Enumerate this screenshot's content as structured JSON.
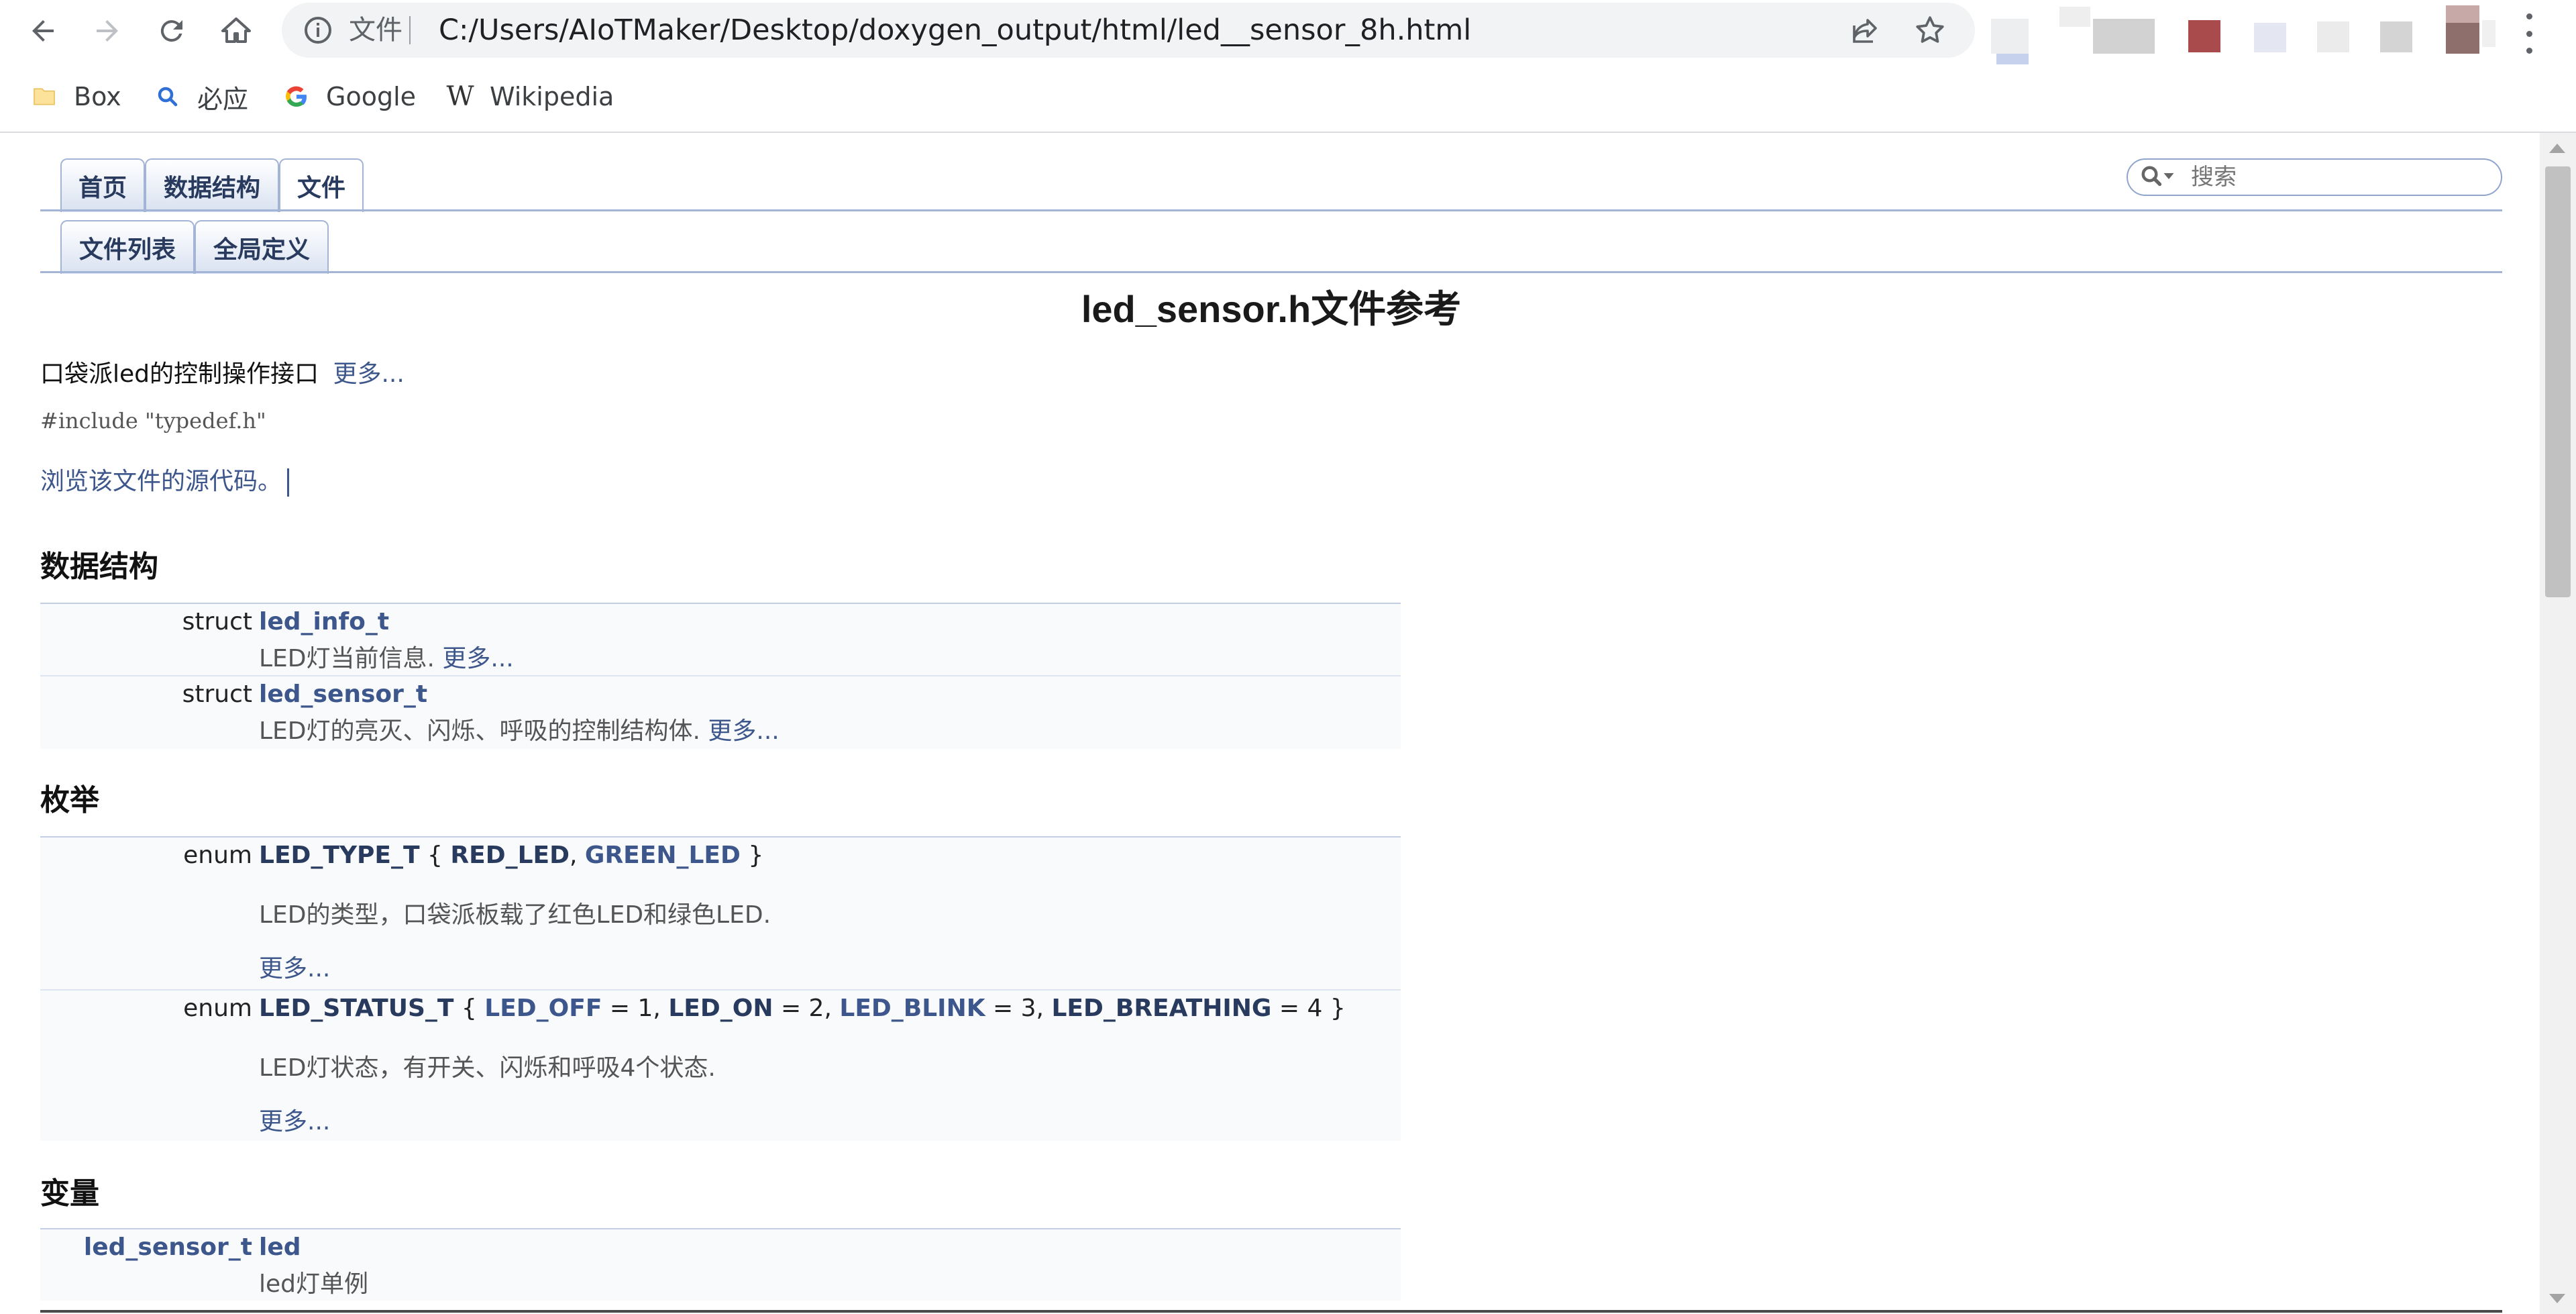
{
  "browser": {
    "address_scheme": "文件",
    "address_url": "C:/Users/AIoTMaker/Desktop/doxygen_output/html/led__sensor_8h.html",
    "bookmarks": [
      {
        "label": "Box",
        "icon": "folder-icon"
      },
      {
        "label": "必应",
        "icon": "search-icon"
      },
      {
        "label": "Google",
        "icon": "google-icon"
      },
      {
        "label": "Wikipedia",
        "icon": "wikipedia-icon"
      }
    ],
    "accent": "#1a73e8"
  },
  "nav": {
    "tabs": [
      "首页",
      "数据结构",
      "文件"
    ],
    "subtabs": [
      "文件列表",
      "全局定义"
    ],
    "search_placeholder": "搜索"
  },
  "page": {
    "title": "led_sensor.h文件参考",
    "brief": "口袋派led的控制操作接口",
    "more": "更多...",
    "include": "#include \"typedef.h\"",
    "source_link": "浏览该文件的源代码。"
  },
  "sections": {
    "structs": {
      "heading": "数据结构",
      "rows": [
        {
          "kind": "struct",
          "name": "led_info_t",
          "desc": "LED灯当前信息.",
          "more": "更多..."
        },
        {
          "kind": "struct",
          "name": "led_sensor_t",
          "desc": "LED灯的亮灭、闪烁、呼吸的控制结构体.",
          "more": "更多..."
        }
      ]
    },
    "enums": {
      "heading": "枚举",
      "rows": [
        {
          "kind": "enum",
          "name": "LED_TYPE_T",
          "open": "{",
          "v1": "RED_LED",
          "v2": "GREEN_LED",
          "close": "}",
          "desc": "LED的类型，口袋派板载了红色LED和绿色LED.",
          "more": "更多..."
        },
        {
          "kind": "enum",
          "name": "LED_STATUS_T",
          "open": "{",
          "v1": "LED_OFF",
          "e1": "= 1,",
          "v2": "LED_ON",
          "e2": "= 2,",
          "v3": "LED_BLINK",
          "e3": "= 3,",
          "v4": "LED_BREATHING",
          "e4": "= 4",
          "close": "}",
          "desc": "LED灯状态，有开关、闪烁和呼吸4个状态.",
          "more": "更多..."
        }
      ]
    },
    "vars": {
      "heading": "变量",
      "rows": [
        {
          "type": "led_sensor_t",
          "name": "led",
          "desc": "led灯单例"
        }
      ]
    }
  }
}
